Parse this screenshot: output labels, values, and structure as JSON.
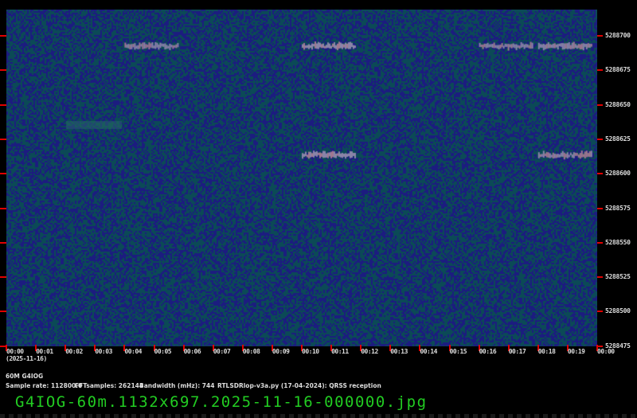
{
  "y_axis": {
    "labels": [
      "5288700",
      "5288675",
      "5288650",
      "5288625",
      "5288600",
      "5288575",
      "5288550",
      "5288525",
      "5288500",
      "5288475"
    ]
  },
  "x_axis": {
    "labels": [
      "00:00",
      "00:01",
      "00:02",
      "00:03",
      "00:04",
      "00:05",
      "00:06",
      "00:07",
      "00:08",
      "00:09",
      "00:10",
      "00:11",
      "00:12",
      "00:13",
      "00:14",
      "00:15",
      "00:16",
      "00:17",
      "00:18",
      "00:19",
      "00:00"
    ],
    "date": "(2025-11-16)"
  },
  "info": {
    "station": "60M G4IOG",
    "sample_rate": "Sample rate: 112800.0",
    "fft_samples": "FFTsamples: 262144",
    "bandwidth": "Bandwidth (mHz): 744",
    "software": "RTLSDRlop-v3a.py (17-04-2024): QRSS reception"
  },
  "filename": "G4IOG-60m.1132x697.2025-11-16-000000.jpg",
  "colors": {
    "background": "#0b4a56",
    "noise": "#1c1c80",
    "signal": "#8a84a8",
    "tick": "#e00000",
    "filename": "#22cc22"
  },
  "signals": [
    {
      "freq_hz": 5288692,
      "start_min": 4.0,
      "end_min": 5.8
    },
    {
      "freq_hz": 5288692,
      "start_min": 10.0,
      "end_min": 11.8
    },
    {
      "freq_hz": 5288692,
      "start_min": 16.0,
      "end_min": 17.8
    },
    {
      "freq_hz": 5288692,
      "start_min": 18.0,
      "end_min": 19.8
    },
    {
      "freq_hz": 5288613,
      "start_min": 10.0,
      "end_min": 11.8
    },
    {
      "freq_hz": 5288613,
      "start_min": 18.0,
      "end_min": 19.8
    }
  ]
}
